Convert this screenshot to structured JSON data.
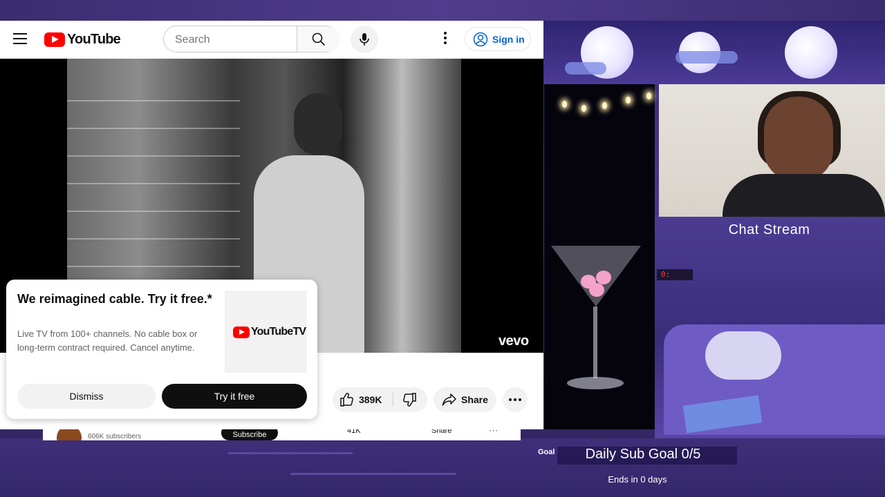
{
  "youtube": {
    "logo_text": "YouTube",
    "search_placeholder": "Search",
    "sign_in_label": "Sign in",
    "watermark": "vevo",
    "actions": {
      "like_count": "389K",
      "share_label": "Share"
    }
  },
  "promo": {
    "title": "We reimagined cable. Try it free.*",
    "description": "Live TV from 100+ channels. No cable box or long-term contract required. Cancel anytime.",
    "logo_text": "YouTubeTV",
    "dismiss_label": "Dismiss",
    "try_label": "Try it free"
  },
  "second_window": {
    "subscribers": "606K subscribers",
    "subscribe_label": "Subscribe",
    "like_count": "41K",
    "share_label": "Share"
  },
  "stream_overlay": {
    "chat_title": "Chat Stream",
    "goal_tag": "Goal",
    "goal_text": "Daily Sub Goal 0/5",
    "goal_ends": "Ends in 0 days",
    "clock_text": "0:"
  },
  "colors": {
    "brand_red": "#ff0000",
    "link_blue": "#065fd4",
    "overlay_purple": "#4a3785"
  },
  "icons": [
    "menu-icon",
    "search-icon",
    "mic-icon",
    "more-vert-icon",
    "account-icon",
    "thumb-up-icon",
    "thumb-down-icon",
    "share-icon",
    "more-horiz-icon"
  ]
}
